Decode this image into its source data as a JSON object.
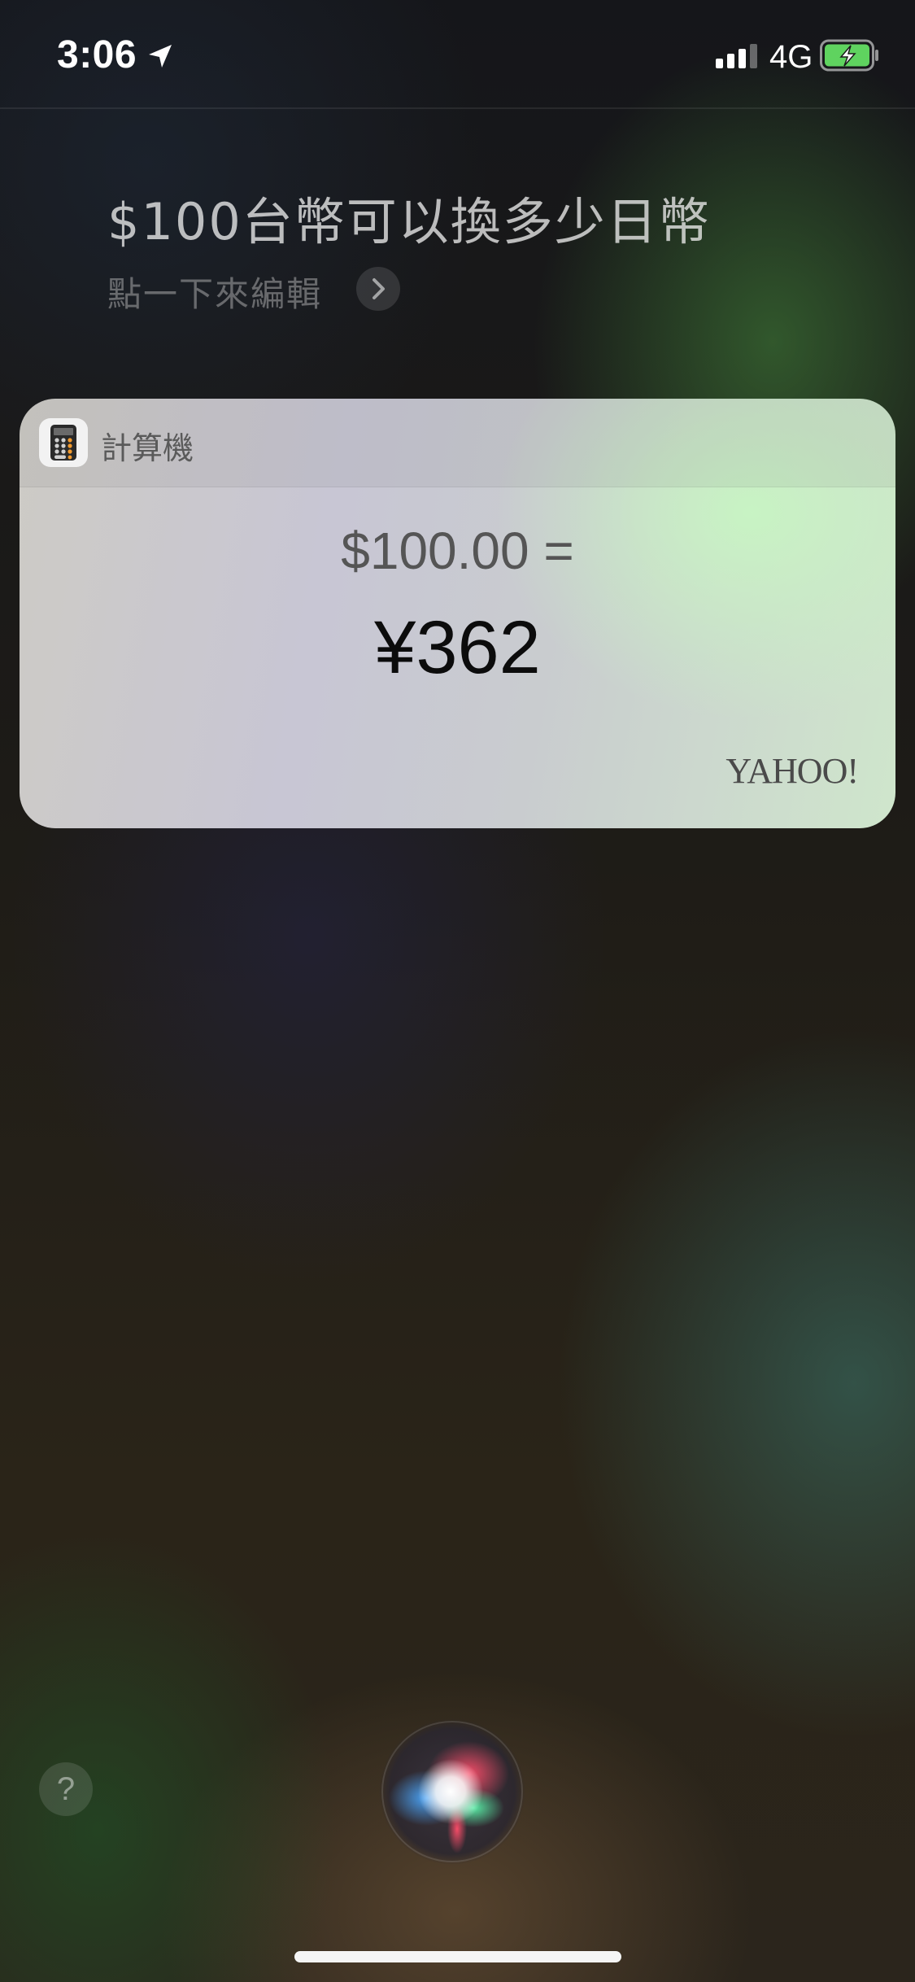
{
  "status_bar": {
    "time": "3:06",
    "network": "4G",
    "icons": [
      "location-arrow-icon",
      "signal-bars-icon",
      "battery-charging-icon"
    ],
    "battery_color": "#5fd35f"
  },
  "siri": {
    "query": "$100台幣可以換多少日幣",
    "edit_hint": "點一下來編輯"
  },
  "card": {
    "app_name": "計算機",
    "app_icon": "calculator-icon",
    "input_value": "$100.00 =",
    "result_value": "¥362",
    "provider": "YAHOO!"
  },
  "help": {
    "label": "?"
  },
  "colors": {
    "card_accent": "#c8f5c3",
    "text_primary": "#0c0c0c"
  }
}
